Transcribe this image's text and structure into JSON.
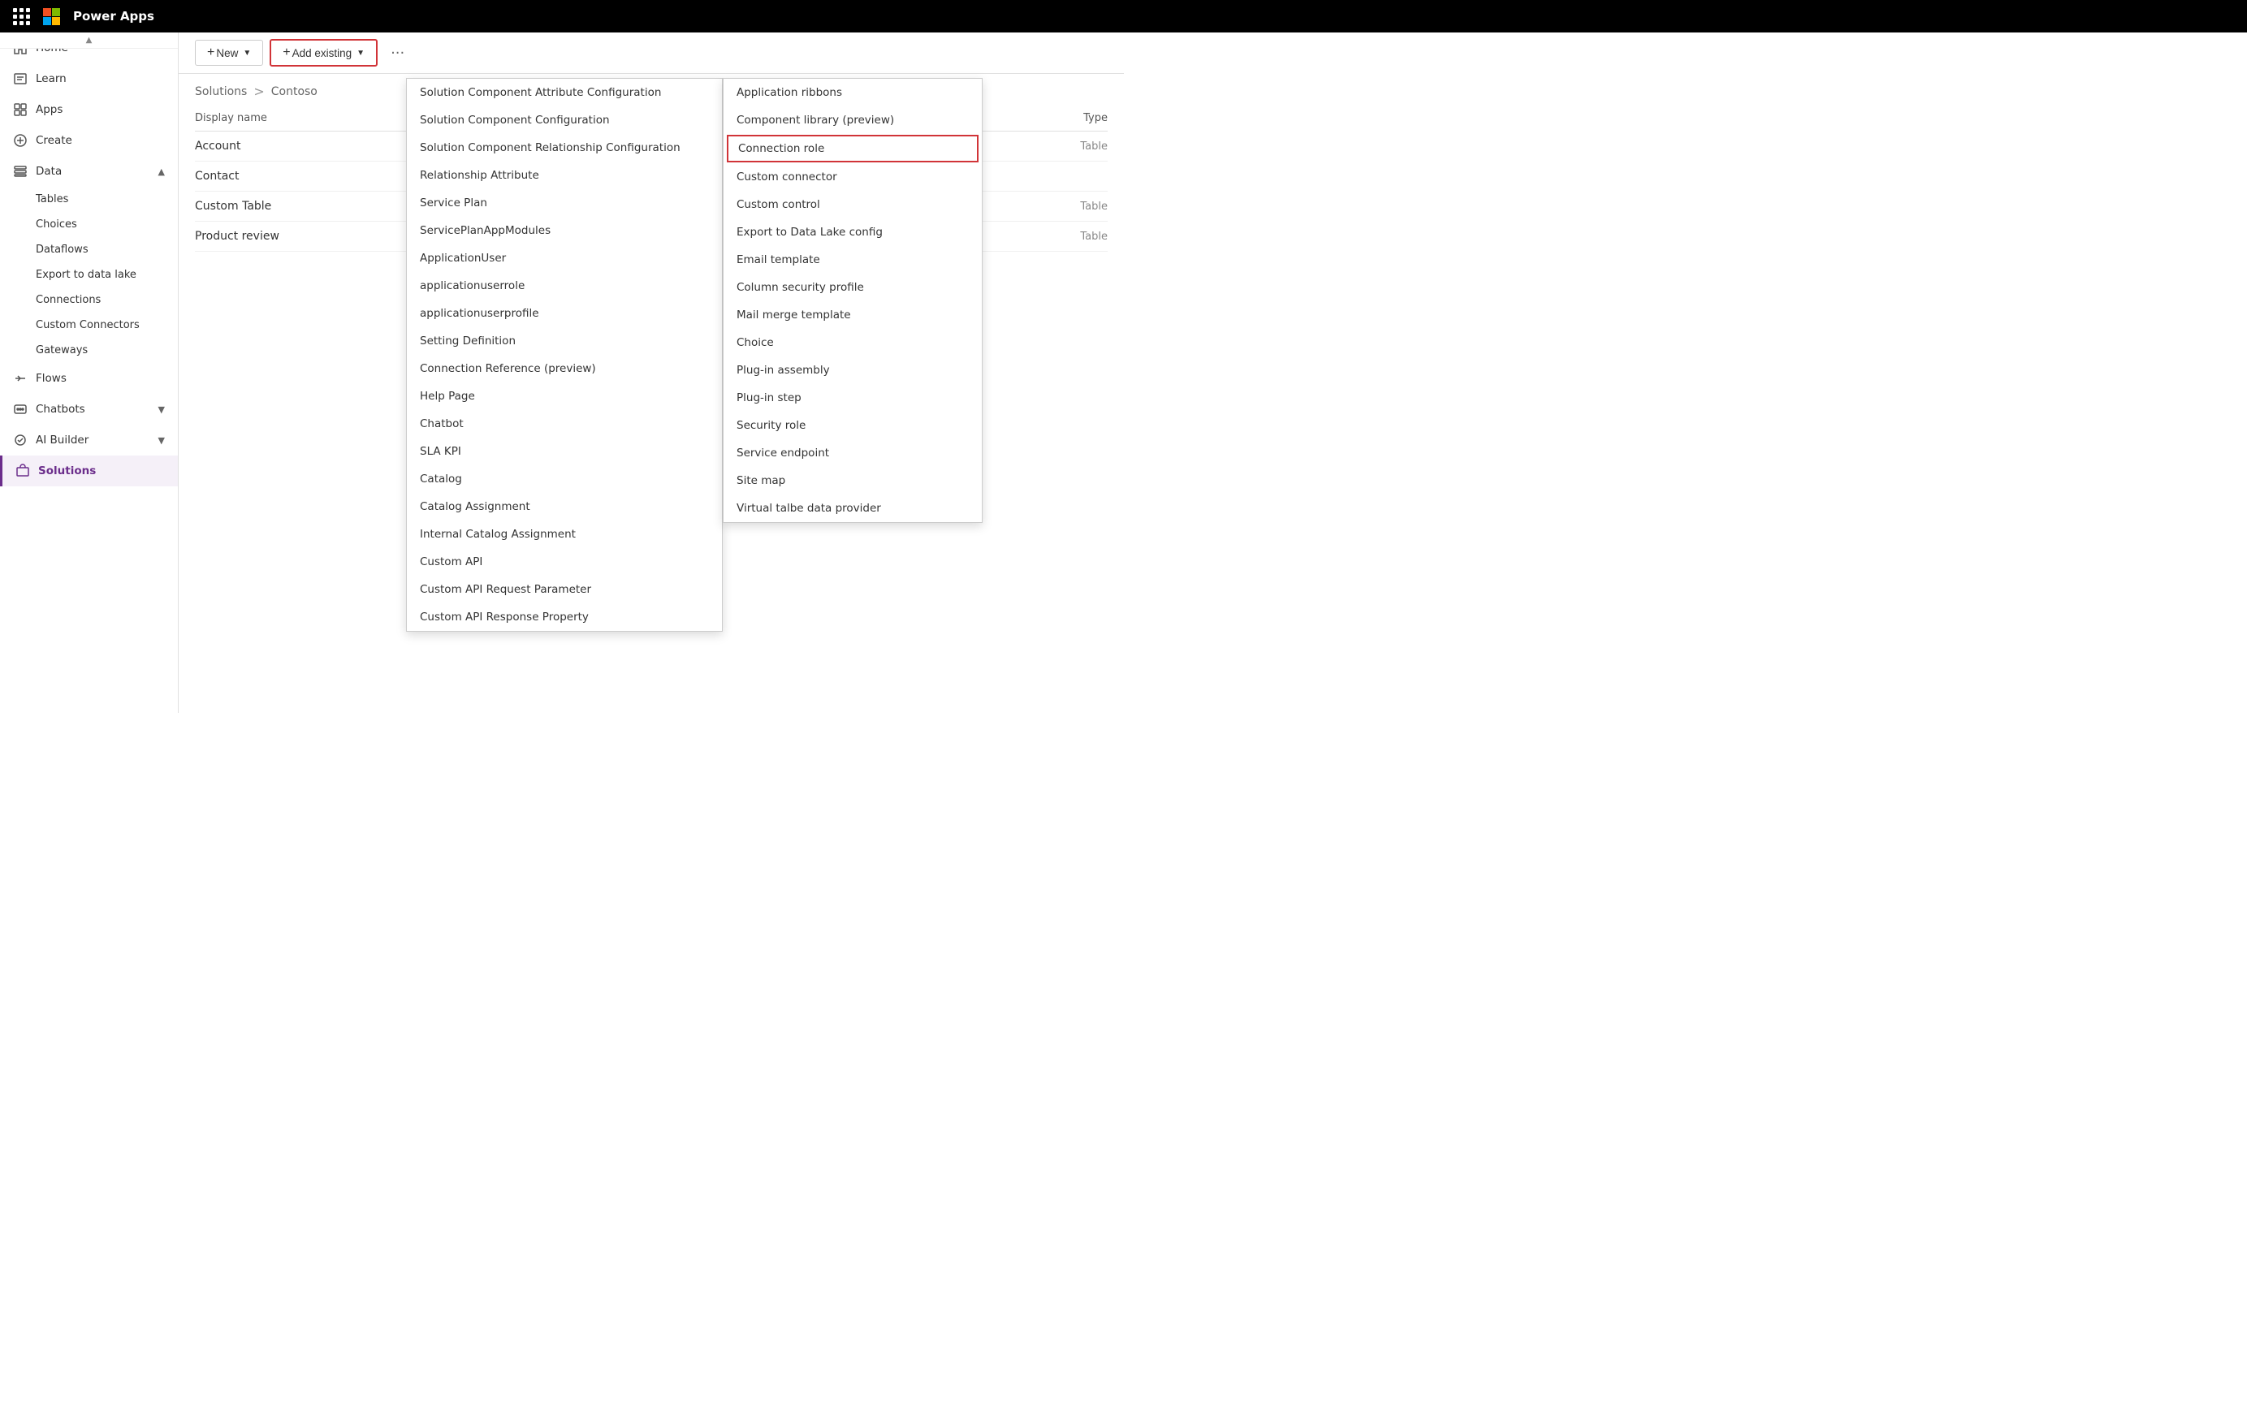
{
  "topbar": {
    "app_name": "Power Apps"
  },
  "sidebar": {
    "items": [
      {
        "id": "home",
        "label": "Home",
        "icon": "home"
      },
      {
        "id": "learn",
        "label": "Learn",
        "icon": "learn"
      },
      {
        "id": "apps",
        "label": "Apps",
        "icon": "apps"
      },
      {
        "id": "create",
        "label": "Create",
        "icon": "create"
      },
      {
        "id": "data",
        "label": "Data",
        "icon": "data",
        "expanded": true
      },
      {
        "id": "flows",
        "label": "Flows",
        "icon": "flows"
      },
      {
        "id": "chatbots",
        "label": "Chatbots",
        "icon": "chatbots",
        "has_chevron": true
      },
      {
        "id": "ai-builder",
        "label": "AI Builder",
        "icon": "ai",
        "has_chevron": true
      },
      {
        "id": "solutions",
        "label": "Solutions",
        "icon": "solutions",
        "active": true
      }
    ],
    "data_sub_items": [
      "Tables",
      "Choices",
      "Dataflows",
      "Export to data lake",
      "Connections",
      "Custom Connectors",
      "Gateways"
    ]
  },
  "toolbar": {
    "new_label": "+ New",
    "add_existing_label": "+ Add existing",
    "more_options_label": "···"
  },
  "breadcrumb": {
    "solutions": "Solutions",
    "separator": ">",
    "current": "Contoso"
  },
  "table": {
    "col_display": "Display name",
    "col_type": "Type",
    "rows": [
      {
        "name": "Account",
        "type": "Table"
      },
      {
        "name": "Contact",
        "type": ""
      },
      {
        "name": "Custom Table",
        "type": "Table"
      },
      {
        "name": "Product review",
        "type": "Table"
      }
    ]
  },
  "dropdown_left": {
    "items": [
      "Solution Component Attribute Configuration",
      "Solution Component Configuration",
      "Solution Component Relationship Configuration",
      "Relationship Attribute",
      "Service Plan",
      "ServicePlanAppModules",
      "ApplicationUser",
      "applicationuserrole",
      "applicationuserprofile",
      "Setting Definition",
      "Connection Reference (preview)",
      "Help Page",
      "Chatbot",
      "SLA KPI",
      "Catalog",
      "Catalog Assignment",
      "Internal Catalog Assignment",
      "Custom API",
      "Custom API Request Parameter",
      "Custom API Response Property"
    ]
  },
  "dropdown_right": {
    "items": [
      "Application ribbons",
      "Component library (preview)",
      "Connection role",
      "Custom connector",
      "Custom control",
      "Export to Data Lake config",
      "Email template",
      "Column security profile",
      "Mail merge template",
      "Choice",
      "Plug-in assembly",
      "Plug-in step",
      "Security role",
      "Service endpoint",
      "Site map",
      "Virtual talbe data provider"
    ],
    "highlighted": "Connection role"
  }
}
